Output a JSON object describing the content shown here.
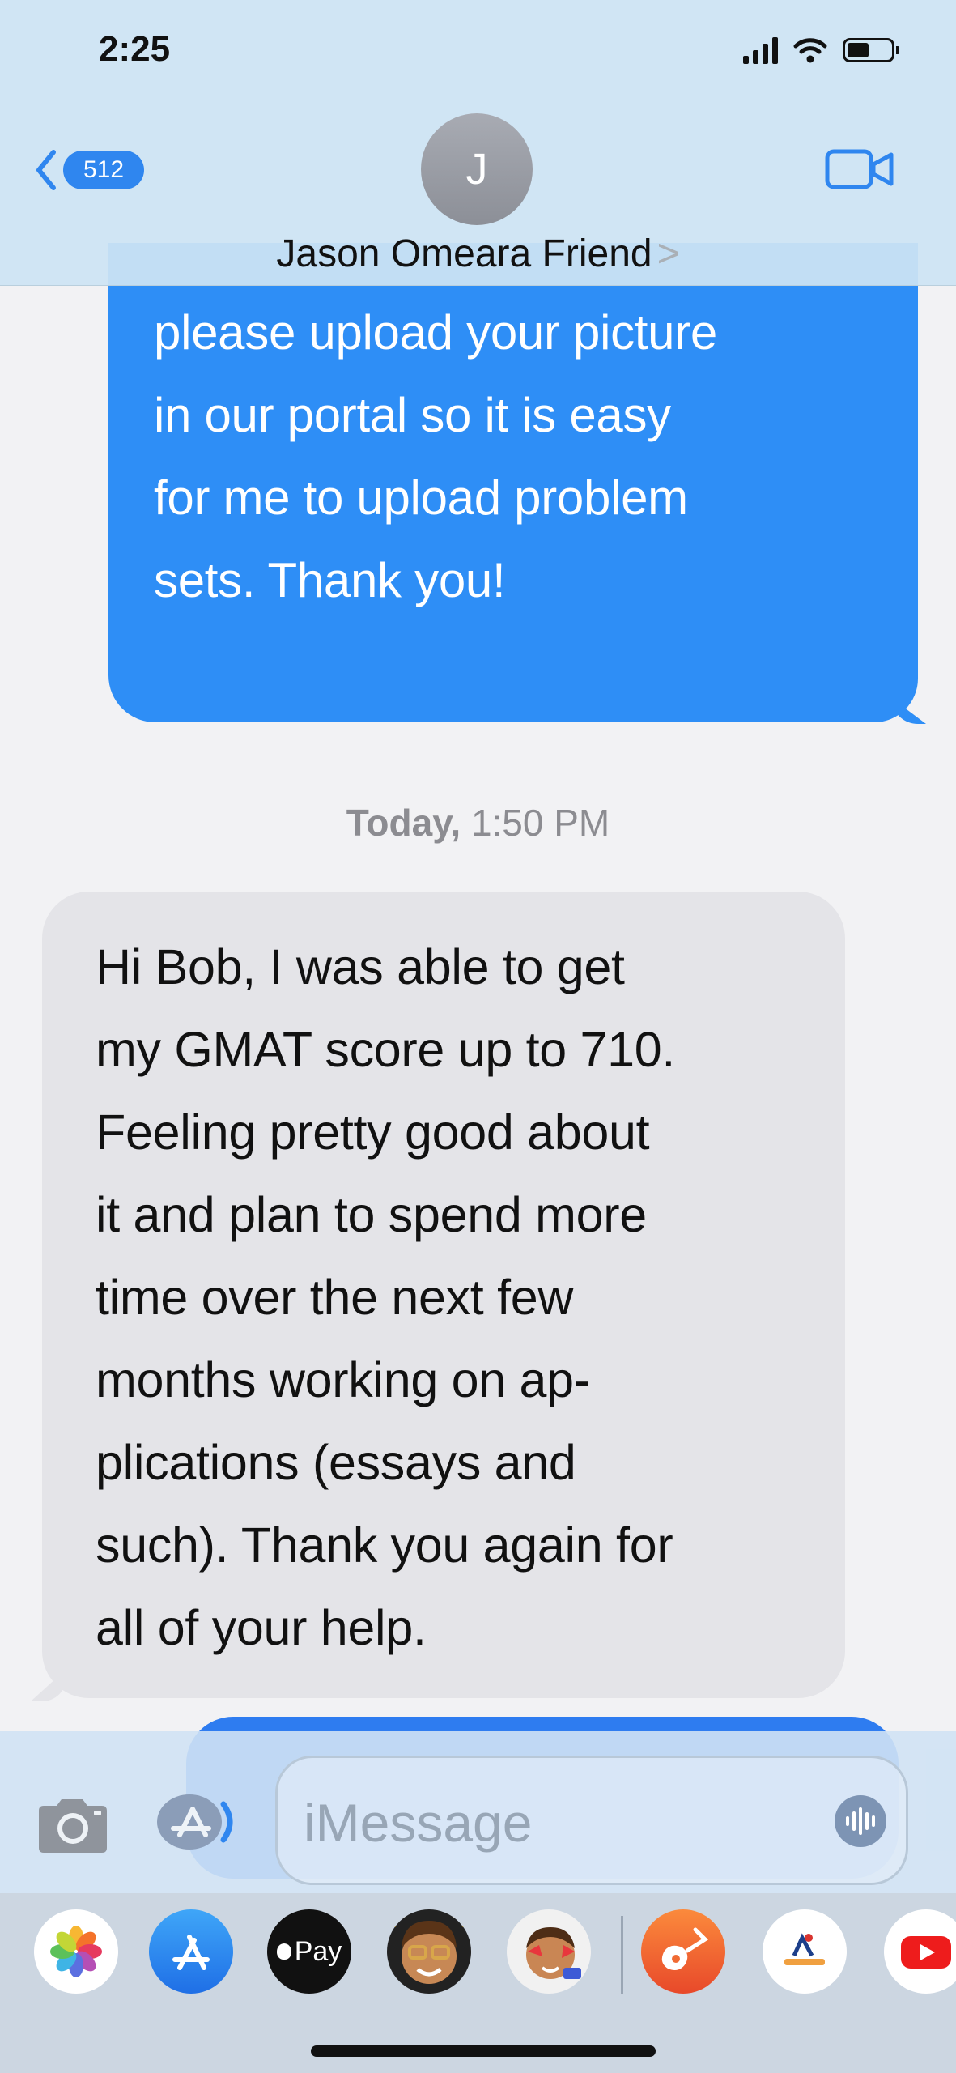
{
  "status_bar": {
    "time": "2:25"
  },
  "header": {
    "back_badge": "512",
    "avatar_initial": "J",
    "contact_name": "Jason Omeara Friend",
    "chevron": ">"
  },
  "messages": [
    {
      "type": "sent",
      "text": "please upload your picture\nin our portal so it is easy\nfor me to upload problem\nsets. Thank you!"
    },
    {
      "type": "timestamp",
      "day": "Today,",
      "time": "1:50 PM"
    },
    {
      "type": "received",
      "text": "Hi Bob, I was able to get\nmy GMAT score up to 710.\nFeeling pretty good about\nit and plan to spend more\ntime over the next few\nmonths working on ap-\nplications (essays and\nsuch). Thank you again for\nall of your help."
    }
  ],
  "input_bar": {
    "placeholder": "iMessage"
  },
  "app_drawer": {
    "apple_pay_label": "Pay",
    "apps": [
      "photos-icon",
      "app-store-icon",
      "apple-pay-icon",
      "memoji-icon",
      "memoji-stickers-icon",
      "garageband-icon",
      "web-app-icon",
      "youtube-icon"
    ]
  },
  "colors": {
    "sent_bubble": "#2e8ef6",
    "received_bubble": "#e4e4e8",
    "background": "#f2f2f4",
    "header": "#cde4f3",
    "accent": "#2f86ef"
  }
}
